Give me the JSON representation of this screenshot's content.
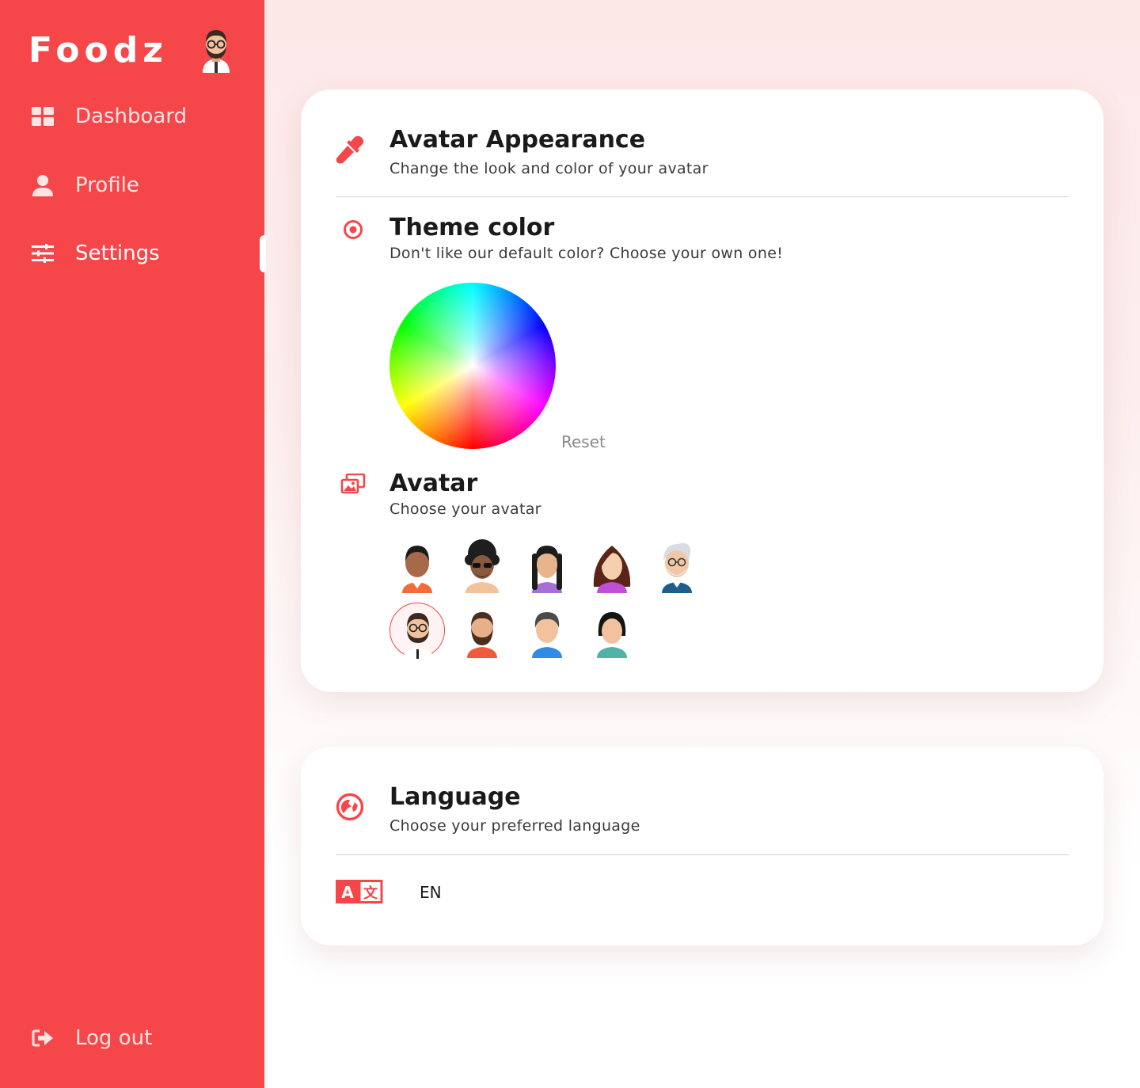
{
  "sidebar": {
    "brand": "Foodz",
    "nav": [
      {
        "label": "Dashboard",
        "icon": "dashboard-grid-icon"
      },
      {
        "label": "Profile",
        "icon": "user-icon"
      },
      {
        "label": "Settings",
        "icon": "sliders-icon",
        "active": true
      }
    ],
    "logout": {
      "label": "Log out",
      "icon": "logout-icon"
    }
  },
  "appearance": {
    "title": "Avatar Appearance",
    "subtitle": "Change the look and color of your avatar",
    "icon": "color-picker-icon",
    "theme": {
      "title": "Theme color",
      "subtitle": "Don't like our default color? Choose your own one!",
      "icon": "target-icon",
      "reset_label": "Reset"
    },
    "avatar": {
      "title": "Avatar",
      "subtitle": "Choose your avatar",
      "icon": "images-icon",
      "options": [
        {
          "name": "avatar-man-dark-short-hair"
        },
        {
          "name": "avatar-man-afro-sunglasses"
        },
        {
          "name": "avatar-woman-braids"
        },
        {
          "name": "avatar-woman-long-hair"
        },
        {
          "name": "avatar-old-man-glasses"
        },
        {
          "name": "avatar-man-glasses-beard",
          "selected": true
        },
        {
          "name": "avatar-man-beard"
        },
        {
          "name": "avatar-man-gray-hair"
        },
        {
          "name": "avatar-woman-bob"
        }
      ]
    }
  },
  "language": {
    "title": "Language",
    "subtitle": "Choose your preferred language",
    "icon": "globe-icon",
    "translate_icon": "translate-icon",
    "current": "EN"
  },
  "colors": {
    "accent": "#f5474a",
    "background": "#fde8e8"
  }
}
